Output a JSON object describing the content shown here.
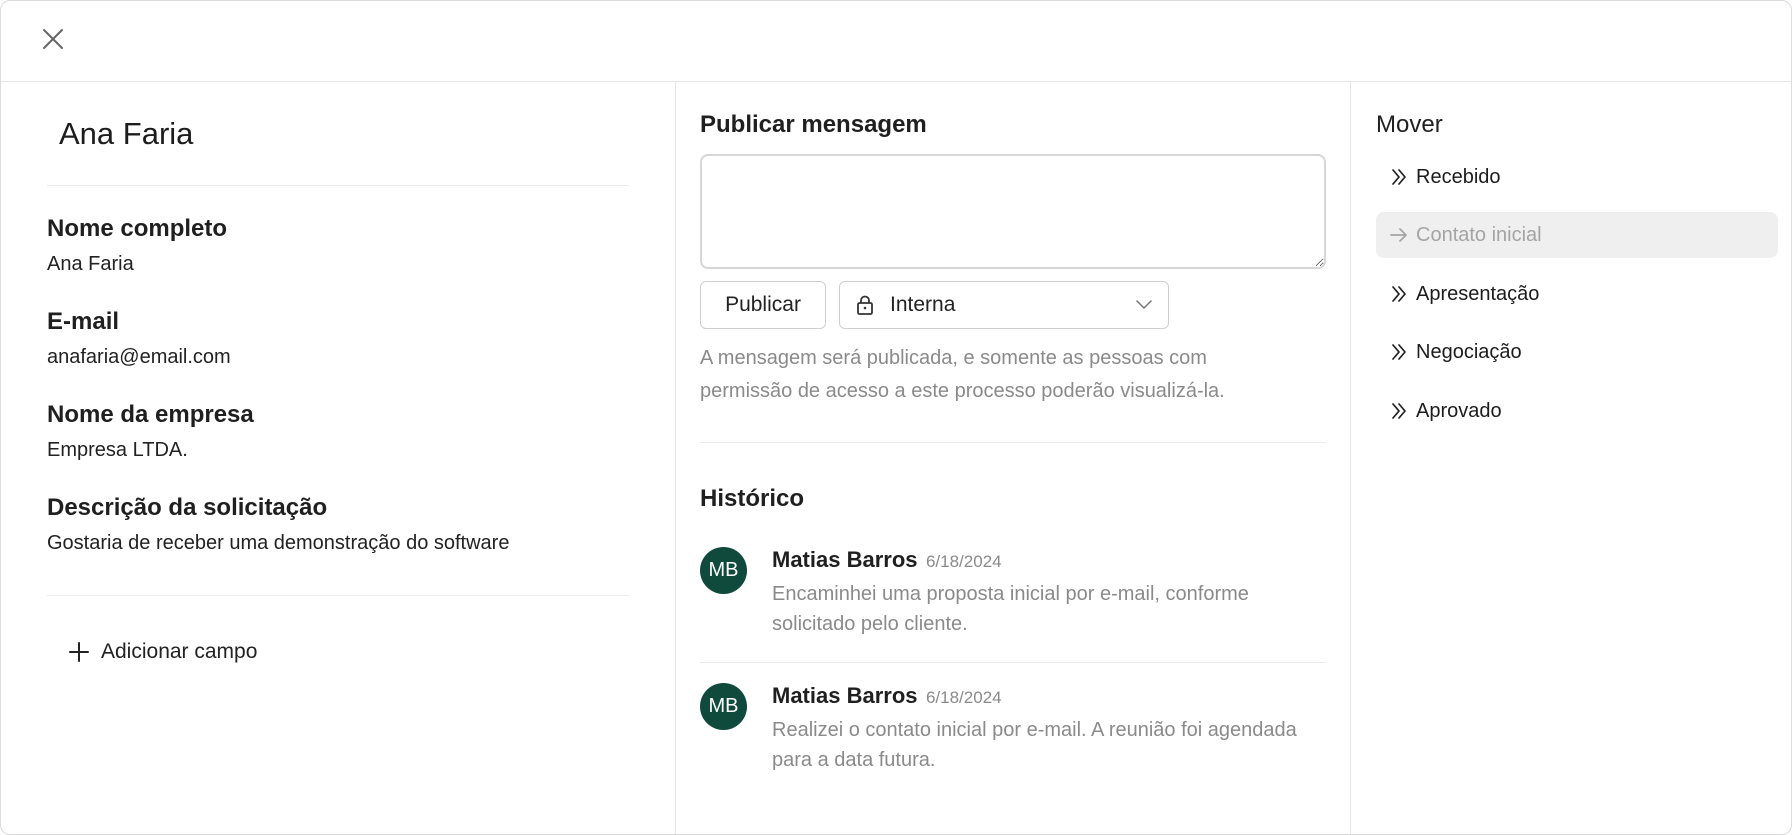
{
  "header": {
    "close_icon": "close-icon"
  },
  "contact": {
    "name": "Ana Faria",
    "fields": [
      {
        "label": "Nome completo",
        "value": "Ana Faria"
      },
      {
        "label": "E-mail",
        "value": "anafaria@email.com"
      },
      {
        "label": "Nome da empresa",
        "value": "Empresa LTDA."
      },
      {
        "label": "Descrição da solicitação",
        "value": "Gostaria de receber uma demonstração do software"
      }
    ],
    "add_field_label": "Adicionar campo"
  },
  "publish": {
    "title": "Publicar mensagem",
    "textarea_value": "",
    "publish_button": "Publicar",
    "visibility_selected": "Interna",
    "hint": "A mensagem será publicada, e somente as pessoas com permissão de acesso a este processo poderão visualizá-la."
  },
  "history": {
    "title": "Histórico",
    "items": [
      {
        "initials": "MB",
        "author": "Matias Barros",
        "date": "6/18/2024",
        "text": "Encaminhei uma proposta inicial por e-mail, conforme solicitado pelo cliente."
      },
      {
        "initials": "MB",
        "author": "Matias Barros",
        "date": "6/18/2024",
        "text": "Realizei o contato inicial por e-mail. A reunião foi agendada para a data futura."
      }
    ]
  },
  "move": {
    "title": "Mover",
    "stages": [
      {
        "label": "Recebido",
        "current": false
      },
      {
        "label": "Contato inicial",
        "current": true
      },
      {
        "label": "Apresentação",
        "current": false
      },
      {
        "label": "Negociação",
        "current": false
      },
      {
        "label": "Aprovado",
        "current": false
      }
    ]
  },
  "colors": {
    "avatar_bg": "#0f4a3c",
    "current_stage_bg": "#efefef",
    "muted_text": "#8a8a8a"
  }
}
